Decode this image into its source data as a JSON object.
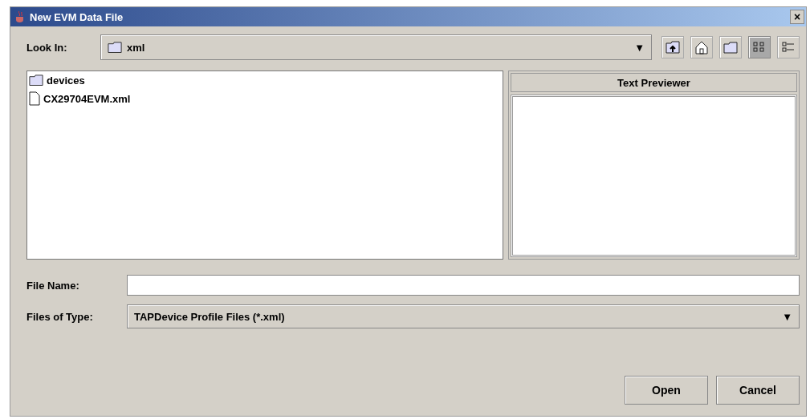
{
  "window": {
    "title": "New EVM Data File",
    "close": "×"
  },
  "look_in": {
    "label": "Look In:",
    "value": "xml",
    "arrow": "▼"
  },
  "toolbar": [
    {
      "kind": "up",
      "selected": false
    },
    {
      "kind": "home",
      "selected": false
    },
    {
      "kind": "newfolder",
      "selected": false
    },
    {
      "kind": "list",
      "selected": true
    },
    {
      "kind": "details",
      "selected": false
    }
  ],
  "files": [
    {
      "kind": "folder",
      "name": "devices"
    },
    {
      "kind": "file",
      "name": "CX29704EVM.xml"
    }
  ],
  "previewer": {
    "title": "Text Previewer"
  },
  "file_name": {
    "label": "File Name:"
  },
  "file_type": {
    "label": "Files of Type:",
    "value": "TAPDevice Profile Files (*.xml)",
    "arrow": "▼"
  },
  "buttons": [
    "Open",
    "Cancel"
  ]
}
